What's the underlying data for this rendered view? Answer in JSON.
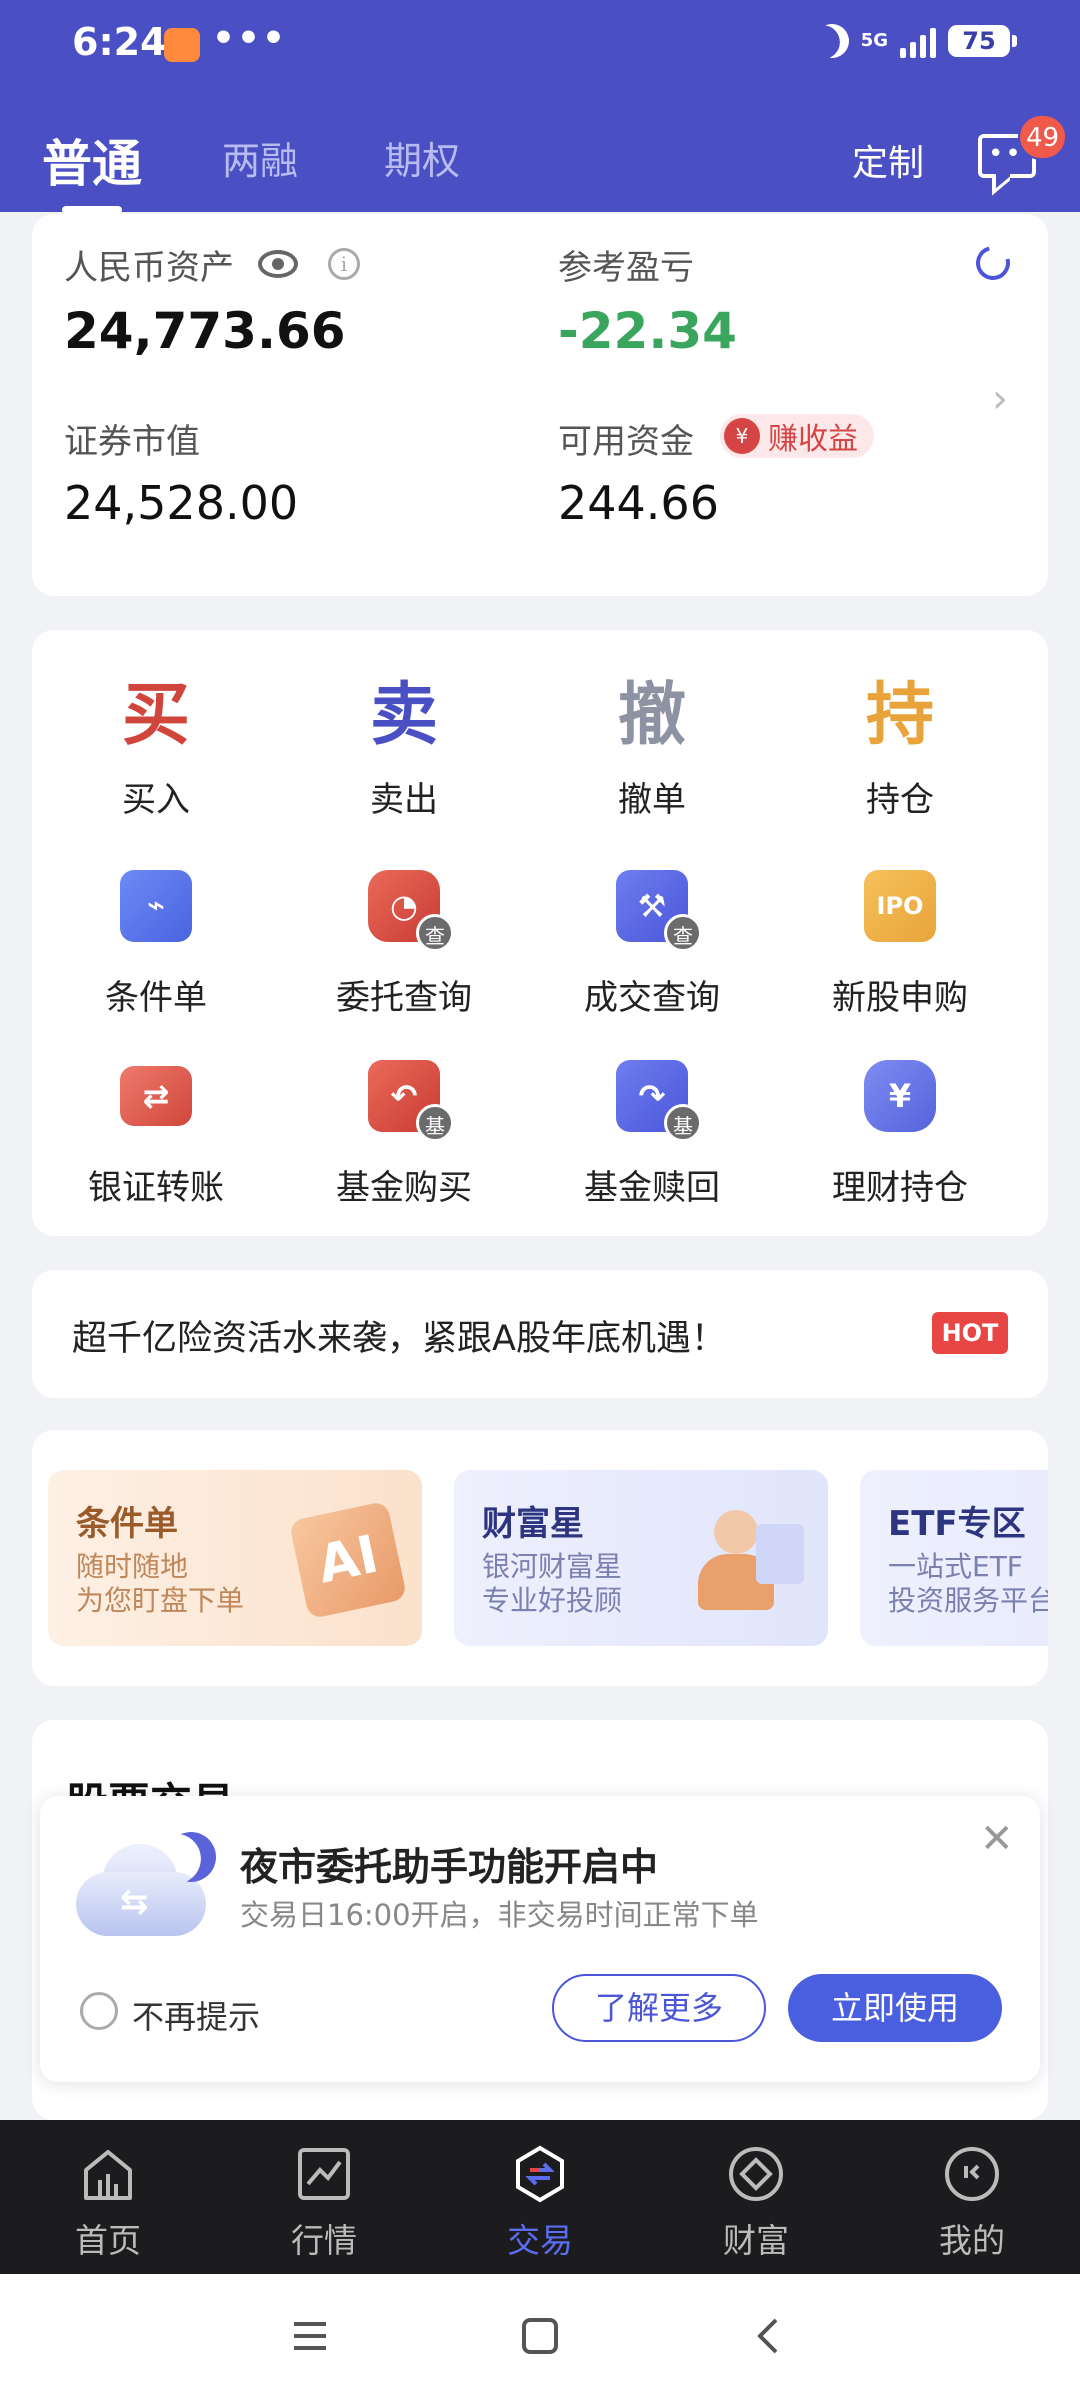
{
  "status_bar": {
    "time": "6:24",
    "dots": "•••",
    "network": "5G",
    "battery": "75"
  },
  "tabs": [
    "普通",
    "两融",
    "期权"
  ],
  "header": {
    "customize_label": "定制",
    "message_badge": "49"
  },
  "assets": {
    "rmb_assets_label": "人民币资产",
    "rmb_assets_value": "24,773.66",
    "ref_pnl_label": "参考盈亏",
    "ref_pnl_value": "-22.34",
    "securities_label": "证券市值",
    "securities_value": "24,528.00",
    "available_label": "可用资金",
    "available_value": "244.66",
    "earn_badge": "赚收益",
    "earn_coin": "¥"
  },
  "trade_actions": [
    {
      "glyph": "买",
      "label": "买入",
      "color": "#d0463c"
    },
    {
      "glyph": "卖",
      "label": "卖出",
      "color": "#4a4fc4"
    },
    {
      "glyph": "撤",
      "label": "撤单",
      "color": "#8e93a3"
    },
    {
      "glyph": "持",
      "label": "持仓",
      "color": "#e8a43a"
    }
  ],
  "function_icons": [
    {
      "label": "条件单",
      "icon": "condition-order-icon"
    },
    {
      "label": "委托查询",
      "icon": "order-query-icon",
      "sub": "查"
    },
    {
      "label": "成交查询",
      "icon": "deal-query-icon",
      "sub": "查"
    },
    {
      "label": "新股申购",
      "icon": "ipo-icon",
      "mark": "IPO"
    },
    {
      "label": "银证转账",
      "icon": "bank-transfer-icon"
    },
    {
      "label": "基金购买",
      "icon": "fund-buy-icon",
      "sub": "基"
    },
    {
      "label": "基金赎回",
      "icon": "fund-redeem-icon",
      "sub": "基"
    },
    {
      "label": "理财持仓",
      "icon": "wealth-holdings-icon",
      "mark": "¥"
    }
  ],
  "banner": {
    "text": "超千亿险资活水来袭，紧跟A股年底机遇！",
    "badge": "HOT"
  },
  "promos": [
    {
      "title": "条件单",
      "line1": "随时随地",
      "line2": "为您盯盘下单",
      "art": "AI"
    },
    {
      "title": "财富星",
      "line1": "银河财富星",
      "line2": "专业好投顾"
    },
    {
      "title": "ETF专区",
      "line1": "一站式ETF",
      "line2": "投资服务平台"
    }
  ],
  "stock_section": {
    "title": "股票交易"
  },
  "popup": {
    "title": "夜市委托助手功能开启中",
    "subtitle": "交易日16:00开启，非交易时间正常下单",
    "dont_remind": "不再提示",
    "learn_more": "了解更多",
    "use_now": "立即使用",
    "close": "✕"
  },
  "bottom_nav": [
    {
      "label": "首页",
      "icon": "home-icon"
    },
    {
      "label": "行情",
      "icon": "market-icon"
    },
    {
      "label": "交易",
      "icon": "trade-icon",
      "active": true
    },
    {
      "label": "财富",
      "icon": "wealth-icon"
    },
    {
      "label": "我的",
      "icon": "profile-icon"
    }
  ]
}
